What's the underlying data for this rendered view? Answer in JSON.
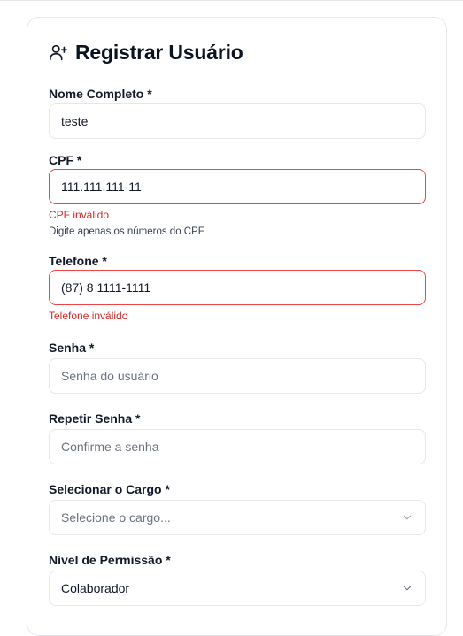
{
  "form": {
    "title": "Registrar Usuário",
    "header_icon": "user-plus-icon",
    "fields": {
      "nome": {
        "label": "Nome Completo *",
        "value": "teste"
      },
      "cpf": {
        "label": "CPF *",
        "value": "111.111.111-11",
        "error": "CPF inválido",
        "help": "Digite apenas os números do CPF"
      },
      "telefone": {
        "label": "Telefone *",
        "value": "(87) 8 1111-1111",
        "error": "Telefone inválido"
      },
      "senha": {
        "label": "Senha *",
        "placeholder": "Senha do usuário"
      },
      "repetir_senha": {
        "label": "Repetir Senha *",
        "placeholder": "Confirme a senha"
      },
      "cargo": {
        "label": "Selecionar o Cargo *",
        "placeholder": "Selecione o cargo..."
      },
      "permissao": {
        "label": "Nível de Permissão *",
        "value": "Colaborador"
      }
    }
  },
  "colors": {
    "error": "#dc2626",
    "error_border": "#ef4444",
    "border": "#e5e7eb",
    "placeholder": "#6b7280"
  }
}
